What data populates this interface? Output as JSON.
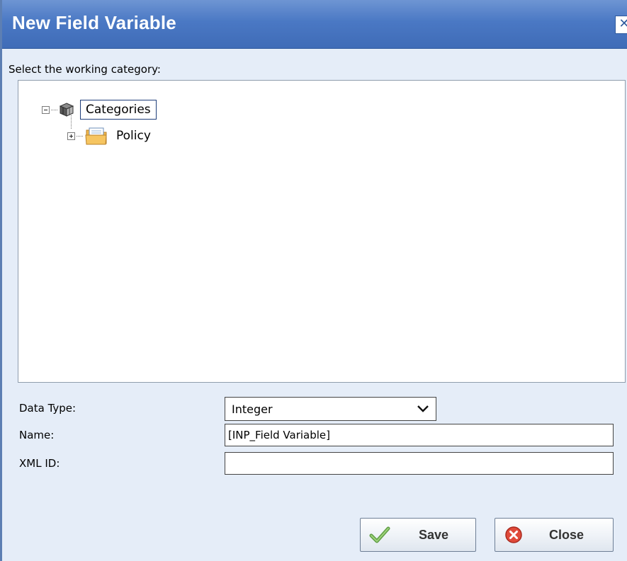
{
  "window": {
    "title": "New Field Variable",
    "close_glyph": "✕"
  },
  "tree": {
    "prompt": "Select the working category:",
    "root": {
      "label": "Categories",
      "icon": "categories-cube-icon",
      "expanded": true,
      "selected": true
    },
    "children": [
      {
        "label": "Policy",
        "icon": "policy-folder-icon",
        "expanded": false
      }
    ]
  },
  "form": {
    "data_type": {
      "label": "Data Type:",
      "value": "Integer"
    },
    "name": {
      "label": "Name:",
      "value": "[INP_Field Variable]"
    },
    "xml_id": {
      "label": "XML ID:",
      "value": ""
    }
  },
  "buttons": {
    "save_label": "Save",
    "close_label": "Close"
  },
  "colors": {
    "title_bar": "#4a78c4",
    "dialog_bg": "#e5edf8",
    "save_check": "#6aa84f",
    "close_icon": "#e04a3a"
  }
}
